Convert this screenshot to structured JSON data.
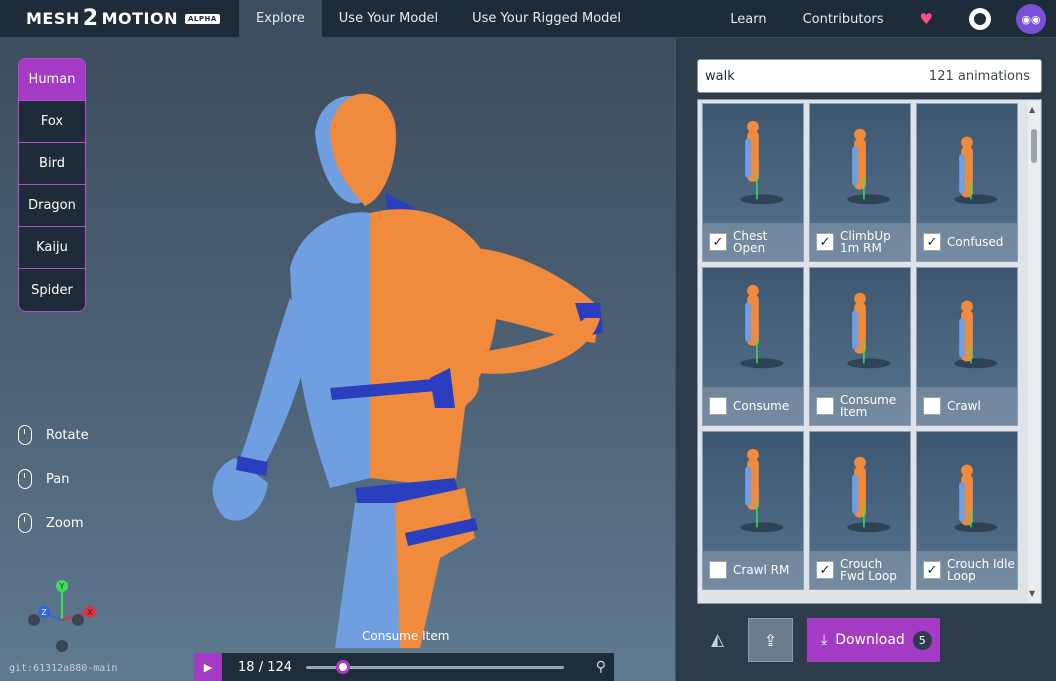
{
  "app": {
    "logo_a": "MESH",
    "logo_two": "2",
    "logo_b": "MOTION",
    "badge": "ALPHA"
  },
  "nav": {
    "tabs": [
      {
        "label": "Explore",
        "active": true
      },
      {
        "label": "Use Your Model",
        "active": false
      },
      {
        "label": "Use Your Rigged Model",
        "active": false
      }
    ],
    "links": [
      "Learn",
      "Contributors"
    ],
    "icons": [
      "heart-icon",
      "github-icon",
      "avatar"
    ]
  },
  "skeletons": [
    {
      "label": "Human",
      "active": true
    },
    {
      "label": "Fox",
      "active": false
    },
    {
      "label": "Bird",
      "active": false
    },
    {
      "label": "Dragon",
      "active": false
    },
    {
      "label": "Kaiju",
      "active": false
    },
    {
      "label": "Spider",
      "active": false
    }
  ],
  "controls": [
    "Rotate",
    "Pan",
    "Zoom"
  ],
  "axes": {
    "x": "X",
    "y": "Y",
    "z": "Z"
  },
  "git": "git:61312a880-main",
  "player": {
    "title": "Consume Item",
    "frame": "18",
    "total": "124",
    "sep": "/",
    "progress": 0.145
  },
  "search": {
    "value": "walk",
    "count": "121 animations"
  },
  "animations": [
    {
      "name": "Chest Open",
      "checked": true
    },
    {
      "name": "ClimbUp 1m RM",
      "checked": true
    },
    {
      "name": "Confused",
      "checked": true
    },
    {
      "name": "Consume",
      "checked": false
    },
    {
      "name": "Consume Item",
      "checked": false
    },
    {
      "name": "Crawl",
      "checked": false
    },
    {
      "name": "Crawl RM",
      "checked": false
    },
    {
      "name": "Crouch Fwd Loop",
      "checked": true
    },
    {
      "name": "Crouch Idle Loop",
      "checked": true
    }
  ],
  "actions": {
    "download_label": "Download",
    "download_count": "5"
  },
  "colors": {
    "accent": "#a33bc4",
    "bg": "#2d3c4b",
    "model_orange": "#f08a3c",
    "model_blue": "#6f9fe0",
    "model_dark": "#2a3fc0"
  }
}
